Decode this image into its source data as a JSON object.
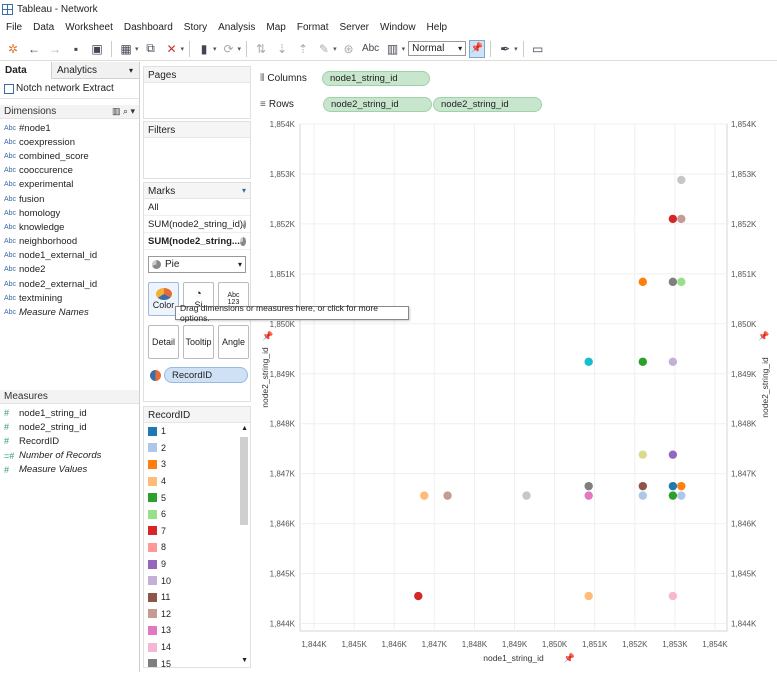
{
  "window": {
    "title": "Tableau - Network"
  },
  "menu": [
    "File",
    "Data",
    "Worksheet",
    "Dashboard",
    "Story",
    "Analysis",
    "Map",
    "Format",
    "Server",
    "Window",
    "Help"
  ],
  "toolbar": {
    "view_mode": "Normal",
    "abc_label": "Abc"
  },
  "data_pane": {
    "tabs": [
      "Data",
      "Analytics"
    ],
    "data_source": "Notch network Extract",
    "dimensions_title": "Dimensions",
    "dimensions": [
      {
        "type": "Abc",
        "label": "#node1",
        "italic": false
      },
      {
        "type": "Abc",
        "label": "coexpression",
        "italic": false
      },
      {
        "type": "Abc",
        "label": "combined_score",
        "italic": false
      },
      {
        "type": "Abc",
        "label": "cooccurence",
        "italic": false
      },
      {
        "type": "Abc",
        "label": "experimental",
        "italic": false
      },
      {
        "type": "Abc",
        "label": "fusion",
        "italic": false
      },
      {
        "type": "Abc",
        "label": "homology",
        "italic": false
      },
      {
        "type": "Abc",
        "label": "knowledge",
        "italic": false
      },
      {
        "type": "Abc",
        "label": "neighborhood",
        "italic": false
      },
      {
        "type": "Abc",
        "label": "node1_external_id",
        "italic": false
      },
      {
        "type": "Abc",
        "label": "node2",
        "italic": false
      },
      {
        "type": "Abc",
        "label": "node2_external_id",
        "italic": false
      },
      {
        "type": "Abc",
        "label": "textmining",
        "italic": false
      },
      {
        "type": "Abc",
        "label": "Measure Names",
        "italic": true
      }
    ],
    "measures_title": "Measures",
    "measures": [
      {
        "type": "#",
        "label": "node1_string_id",
        "italic": false
      },
      {
        "type": "#",
        "label": "node2_string_id",
        "italic": false
      },
      {
        "type": "#",
        "label": "RecordID",
        "italic": false
      },
      {
        "type": "=#",
        "label": "Number of Records",
        "italic": true
      },
      {
        "type": "#",
        "label": "Measure Values",
        "italic": true
      }
    ]
  },
  "pages": {
    "title": "Pages"
  },
  "filters": {
    "title": "Filters"
  },
  "marks": {
    "title": "Marks",
    "all": "All",
    "rows": [
      "SUM(node2_string_id)",
      "SUM(node2_string..."
    ],
    "mark_type": "Pie",
    "buttons": [
      "Color",
      "Size",
      "Label",
      "Detail",
      "Tooltip",
      "Angle"
    ],
    "size_abbrev": "Si",
    "label_abbrev": "Abc\n123",
    "pill": "RecordID",
    "tooltip": "Drag dimensions or measures here, or click for more options."
  },
  "legend": {
    "title": "RecordID",
    "items": [
      {
        "label": "1",
        "color": "#1f77b4"
      },
      {
        "label": "2",
        "color": "#aec7e8"
      },
      {
        "label": "3",
        "color": "#ff7f0e"
      },
      {
        "label": "4",
        "color": "#ffbb78"
      },
      {
        "label": "5",
        "color": "#2ca02c"
      },
      {
        "label": "6",
        "color": "#98df8a"
      },
      {
        "label": "7",
        "color": "#d62728"
      },
      {
        "label": "8",
        "color": "#ff9896"
      },
      {
        "label": "9",
        "color": "#9467bd"
      },
      {
        "label": "10",
        "color": "#c5b0d5"
      },
      {
        "label": "11",
        "color": "#8c564b"
      },
      {
        "label": "12",
        "color": "#c49c94"
      },
      {
        "label": "13",
        "color": "#e377c2"
      },
      {
        "label": "14",
        "color": "#f7b6d2"
      },
      {
        "label": "15",
        "color": "#7f7f7f"
      }
    ]
  },
  "shelves": {
    "columns_label": "Columns",
    "rows_label": "Rows",
    "columns": [
      "node1_string_id"
    ],
    "rows": [
      "node2_string_id",
      "node2_string_id"
    ]
  },
  "chart_data": {
    "type": "scatter",
    "xlabel": "node1_string_id",
    "ylabel": "node2_string_id",
    "x_ticks": [
      "1,844K",
      "1,845K",
      "1,846K",
      "1,847K",
      "1,848K",
      "1,849K",
      "1,850K",
      "1,851K",
      "1,852K",
      "1,853K",
      "1,854K"
    ],
    "y_ticks": [
      "1,854K",
      "1,853K",
      "1,852K",
      "1,851K",
      "1,850K",
      "1,849K",
      "1,848K",
      "1,847K",
      "1,846K",
      "1,845K",
      "1,844K"
    ],
    "xlim": [
      1843650,
      1854300
    ],
    "ylim": [
      1843850,
      1854000
    ],
    "points": [
      {
        "x": 1853160,
        "y": 1852880,
        "color": "#c7c7c7"
      },
      {
        "x": 1852950,
        "y": 1852100,
        "color": "#d62728"
      },
      {
        "x": 1853160,
        "y": 1852100,
        "color": "#c49c94"
      },
      {
        "x": 1852200,
        "y": 1850840,
        "color": "#ff7f0e"
      },
      {
        "x": 1852950,
        "y": 1850840,
        "color": "#7f7f7f"
      },
      {
        "x": 1853160,
        "y": 1850840,
        "color": "#98df8a"
      },
      {
        "x": 1850850,
        "y": 1849240,
        "color": "#17becf"
      },
      {
        "x": 1852200,
        "y": 1849240,
        "color": "#2ca02c"
      },
      {
        "x": 1852950,
        "y": 1849240,
        "color": "#c5b0d5"
      },
      {
        "x": 1852200,
        "y": 1847380,
        "color": "#dbdb8d"
      },
      {
        "x": 1852950,
        "y": 1847380,
        "color": "#9467bd"
      },
      {
        "x": 1846750,
        "y": 1846560,
        "color": "#ffbb78"
      },
      {
        "x": 1847330,
        "y": 1846560,
        "color": "#c49c94"
      },
      {
        "x": 1849300,
        "y": 1846560,
        "color": "#c7c7c7"
      },
      {
        "x": 1850850,
        "y": 1846750,
        "color": "#7f7f7f"
      },
      {
        "x": 1850850,
        "y": 1846560,
        "color": "#e377c2"
      },
      {
        "x": 1852200,
        "y": 1846750,
        "color": "#8c564b"
      },
      {
        "x": 1852200,
        "y": 1846560,
        "color": "#aec7e8"
      },
      {
        "x": 1852950,
        "y": 1846750,
        "color": "#1f77b4"
      },
      {
        "x": 1852950,
        "y": 1846560,
        "color": "#2ca02c"
      },
      {
        "x": 1853160,
        "y": 1846750,
        "color": "#ff7f0e"
      },
      {
        "x": 1853160,
        "y": 1846560,
        "color": "#aec7e8"
      },
      {
        "x": 1846600,
        "y": 1844550,
        "color": "#d62728"
      },
      {
        "x": 1850850,
        "y": 1844550,
        "color": "#ffbb78"
      },
      {
        "x": 1852950,
        "y": 1844550,
        "color": "#f7b6d2"
      }
    ]
  }
}
